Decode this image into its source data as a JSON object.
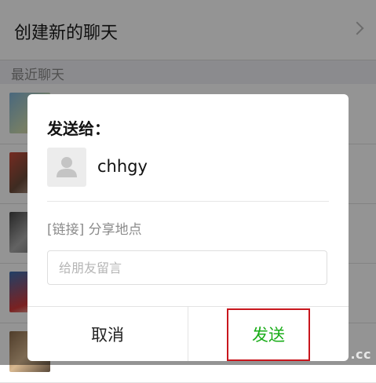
{
  "background": {
    "create_chat_label": "创建新的聊天",
    "recent_chats_header": "最近聊天"
  },
  "dialog": {
    "title": "发送给：",
    "contact_name": "chhgy",
    "share_text": "[链接] 分享地点",
    "message_placeholder": "给朋友留言",
    "cancel_label": "取消",
    "send_label": "发送"
  },
  "watermark": ".cc",
  "colors": {
    "send_green": "#1aad19",
    "highlight_red": "#c8161d",
    "overlay": "rgba(0,0,0,0.42)"
  }
}
